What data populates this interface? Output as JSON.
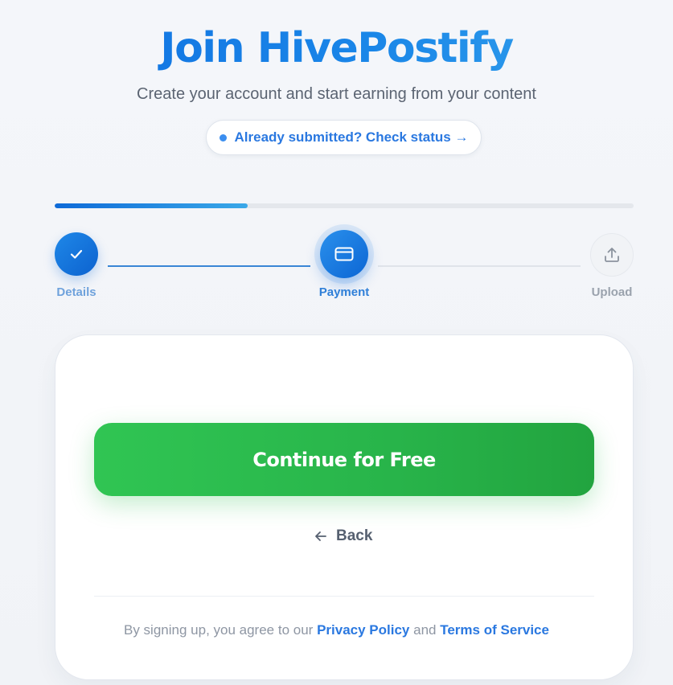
{
  "header": {
    "title": "Join HivePostify",
    "subtitle": "Create your account and start earning from your content",
    "status_link": "Already submitted? Check status →"
  },
  "progress": {
    "fraction": 0.333
  },
  "steps": [
    {
      "label": "Details",
      "state": "completed",
      "icon": "check-icon"
    },
    {
      "label": "Payment",
      "state": "active",
      "icon": "credit-card-icon"
    },
    {
      "label": "Upload",
      "state": "pending",
      "icon": "upload-icon"
    }
  ],
  "card": {
    "primary_button": "Continue for Free",
    "back_label": "Back",
    "back_icon": "arrow-left-icon",
    "terms_prefix": "By signing up, you agree to our",
    "privacy_link": "Privacy Policy",
    "terms_and": "and",
    "terms_link": "Terms of Service"
  },
  "colors": {
    "accent": "#1a7fe6",
    "success": "#2db44c",
    "muted_text": "#8e96a3"
  }
}
